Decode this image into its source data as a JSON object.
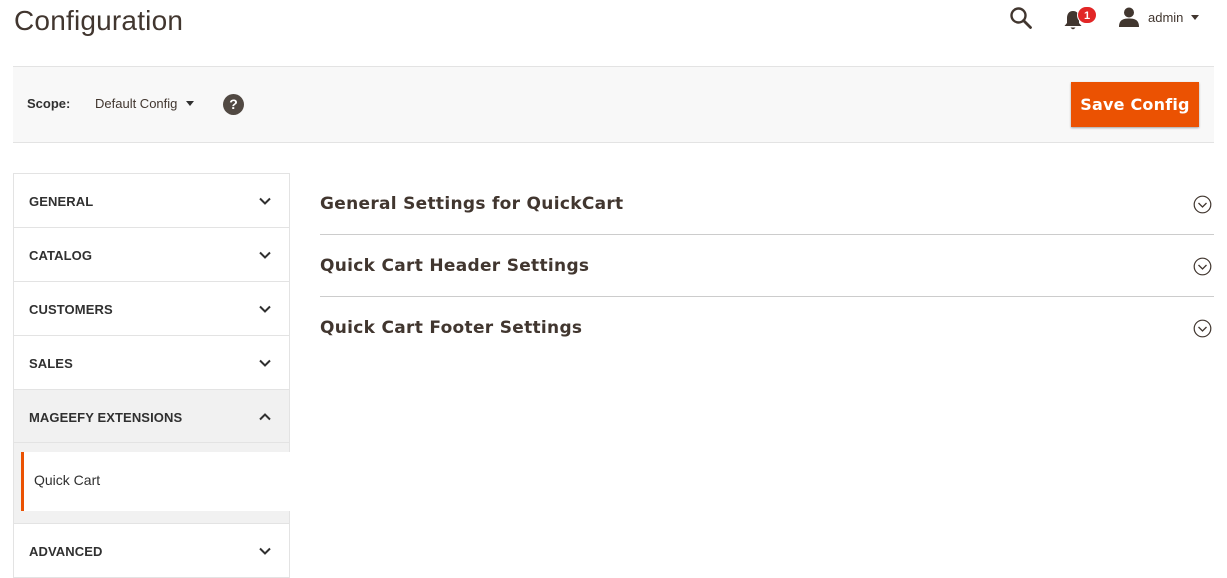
{
  "header": {
    "title": "Configuration",
    "notifications_count": "1",
    "user_name": "admin"
  },
  "toolbar": {
    "scope_label": "Scope:",
    "scope_value": "Default Config",
    "help_glyph": "?",
    "save_label": "Save Config"
  },
  "sidebar": {
    "items": [
      {
        "label": "GENERAL",
        "expanded": false
      },
      {
        "label": "CATALOG",
        "expanded": false
      },
      {
        "label": "CUSTOMERS",
        "expanded": false
      },
      {
        "label": "SALES",
        "expanded": false
      },
      {
        "label": "MAGEEFY EXTENSIONS",
        "expanded": true,
        "children": [
          {
            "label": "Quick Cart",
            "active": true
          }
        ]
      },
      {
        "label": "ADVANCED",
        "expanded": false
      }
    ]
  },
  "sections": [
    {
      "title": "General Settings for QuickCart"
    },
    {
      "title": "Quick Cart Header Settings"
    },
    {
      "title": "Quick Cart Footer Settings"
    }
  ],
  "colors": {
    "accent": "#eb5202",
    "badge": "#e22626",
    "text_dark": "#41362f"
  }
}
